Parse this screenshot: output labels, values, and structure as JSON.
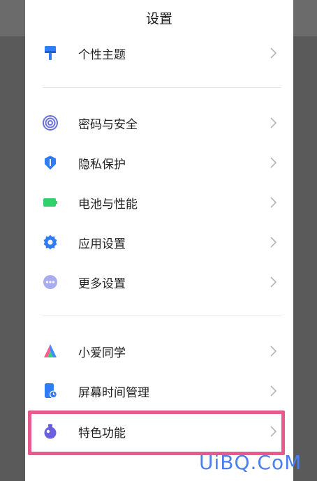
{
  "header": {
    "title": "设置"
  },
  "groups": [
    {
      "items": [
        {
          "label": "个性主题",
          "icon": "paint-brush-icon"
        }
      ]
    },
    {
      "items": [
        {
          "label": "密码与安全",
          "icon": "fingerprint-icon"
        },
        {
          "label": "隐私保护",
          "icon": "shield-icon"
        },
        {
          "label": "电池与性能",
          "icon": "battery-icon"
        },
        {
          "label": "应用设置",
          "icon": "gear-icon"
        },
        {
          "label": "更多设置",
          "icon": "more-dots-icon"
        }
      ]
    },
    {
      "items": [
        {
          "label": "小爱同学",
          "icon": "assistant-icon"
        },
        {
          "label": "屏幕时间管理",
          "icon": "screen-time-icon"
        },
        {
          "label": "特色功能",
          "icon": "feature-icon"
        }
      ]
    }
  ],
  "highlight_target": "特色功能",
  "watermark": {
    "text": "UiBQ.CoM"
  },
  "colors": {
    "accent_blue": "#2f7cf6",
    "battery_green": "#2fd16a",
    "highlight_pink": "#e85a8e",
    "watermark_blue": "#4b7ff0"
  }
}
